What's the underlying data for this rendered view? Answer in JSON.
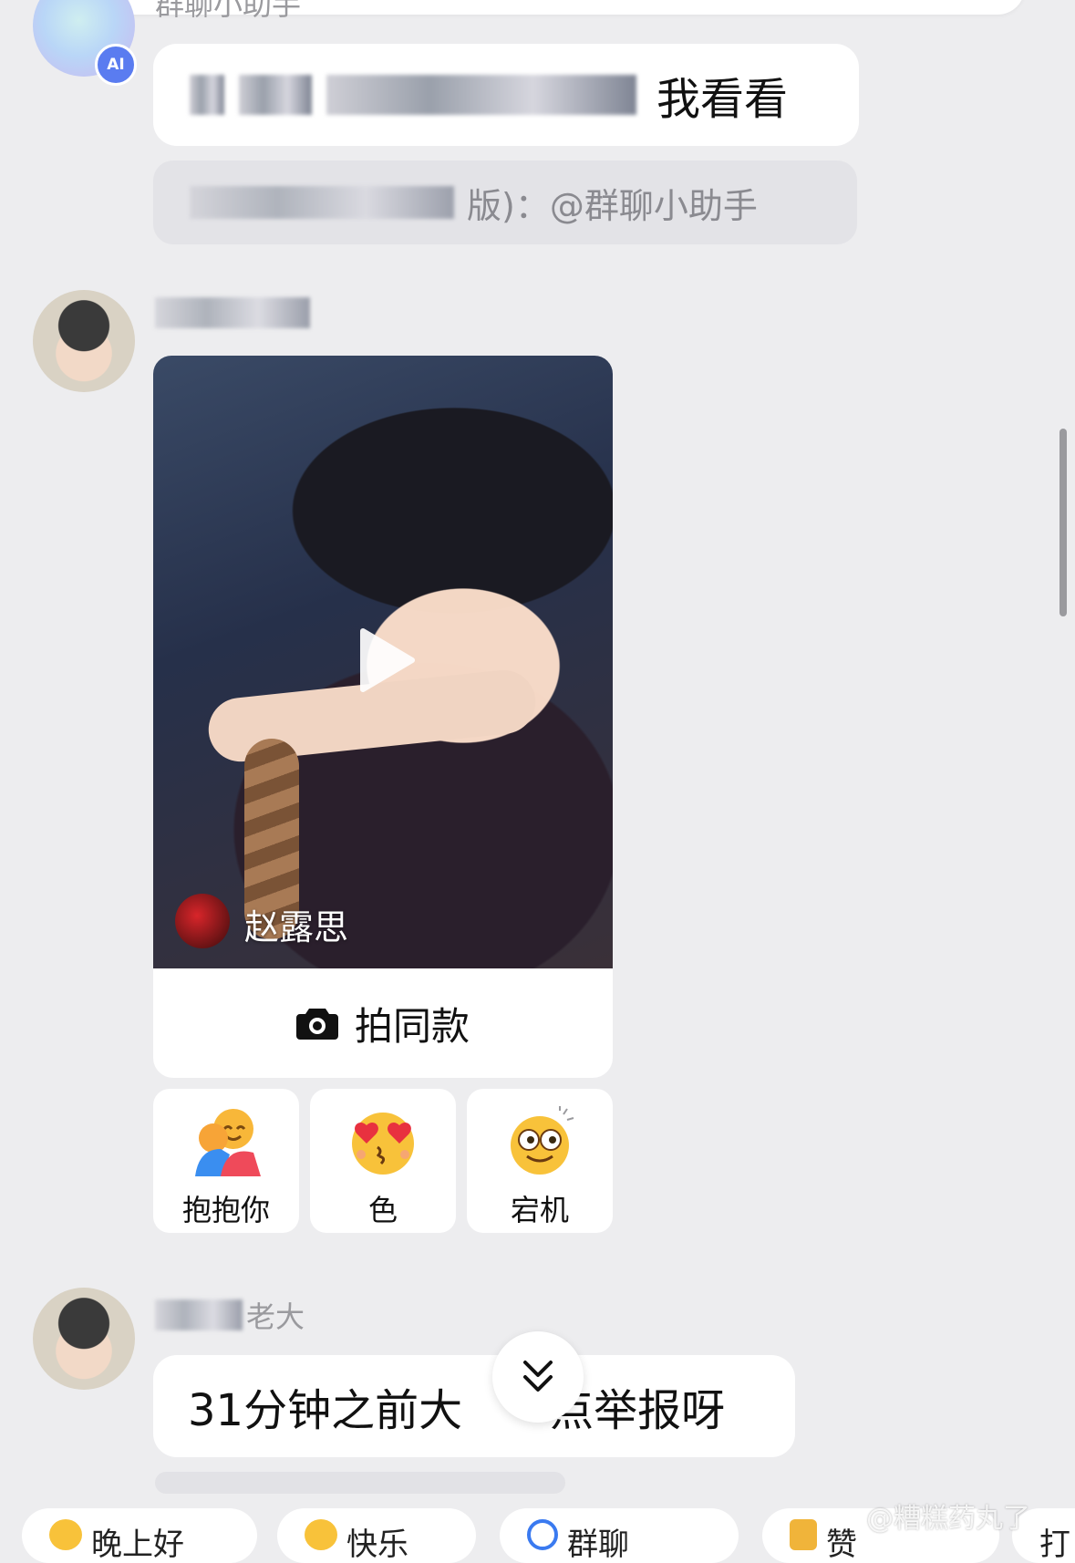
{
  "messages": [
    {
      "sender": "群聊小助手",
      "bubble_text": "我看看",
      "quote_text": "版)：@群聊小助手"
    },
    {
      "video": {
        "creator": "赵露思",
        "shoot_same_label": "拍同款"
      },
      "reactions": [
        {
          "label": "抱抱你",
          "icon": "hug-emoji-icon"
        },
        {
          "label": "色",
          "icon": "heart-eyes-emoji-icon"
        },
        {
          "label": "宕机",
          "icon": "dazed-emoji-icon"
        }
      ]
    },
    {
      "sender": "老大",
      "bubble_text": "31分钟之前大",
      "bubble_text_tail": "点举报呀"
    }
  ],
  "quick_chips": [
    "晚上好",
    "快乐",
    "群聊",
    "赞",
    "打"
  ],
  "watermark": "@糟糕药丸了"
}
